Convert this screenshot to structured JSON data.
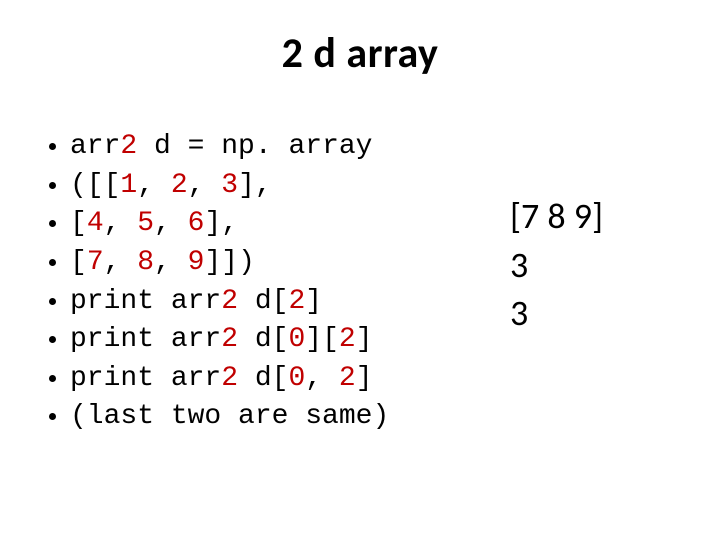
{
  "title": "2 d array",
  "code_lines": [
    [
      {
        "t": "arr",
        "c": "black"
      },
      {
        "t": "2",
        "c": "red"
      },
      {
        "t": " d = np. array",
        "c": "black"
      }
    ],
    [
      {
        "t": "([[",
        "c": "black"
      },
      {
        "t": "1",
        "c": "red"
      },
      {
        "t": ", ",
        "c": "black"
      },
      {
        "t": "2",
        "c": "red"
      },
      {
        "t": ", ",
        "c": "black"
      },
      {
        "t": "3",
        "c": "red"
      },
      {
        "t": "],",
        "c": "black"
      }
    ],
    [
      {
        "t": "[",
        "c": "black"
      },
      {
        "t": "4",
        "c": "red"
      },
      {
        "t": ", ",
        "c": "black"
      },
      {
        "t": "5",
        "c": "red"
      },
      {
        "t": ", ",
        "c": "black"
      },
      {
        "t": "6",
        "c": "red"
      },
      {
        "t": "],",
        "c": "black"
      }
    ],
    [
      {
        "t": "[",
        "c": "black"
      },
      {
        "t": "7",
        "c": "red"
      },
      {
        "t": ", ",
        "c": "black"
      },
      {
        "t": "8",
        "c": "red"
      },
      {
        "t": ", ",
        "c": "black"
      },
      {
        "t": "9",
        "c": "red"
      },
      {
        "t": "]])",
        "c": "black"
      }
    ],
    [
      {
        "t": "print arr",
        "c": "black"
      },
      {
        "t": "2",
        "c": "red"
      },
      {
        "t": " d[",
        "c": "black"
      },
      {
        "t": "2",
        "c": "red"
      },
      {
        "t": "]",
        "c": "black"
      }
    ],
    [
      {
        "t": "print arr",
        "c": "black"
      },
      {
        "t": "2",
        "c": "red"
      },
      {
        "t": " d[",
        "c": "black"
      },
      {
        "t": "0",
        "c": "red"
      },
      {
        "t": "][",
        "c": "black"
      },
      {
        "t": "2",
        "c": "red"
      },
      {
        "t": "]",
        "c": "black"
      }
    ],
    [
      {
        "t": "print arr",
        "c": "black"
      },
      {
        "t": "2",
        "c": "red"
      },
      {
        "t": " d[",
        "c": "black"
      },
      {
        "t": "0",
        "c": "red"
      },
      {
        "t": ", ",
        "c": "black"
      },
      {
        "t": "2",
        "c": "red"
      },
      {
        "t": "]",
        "c": "black"
      }
    ],
    [
      {
        "t": "(last two are same)",
        "c": "black"
      }
    ]
  ],
  "output_lines": [
    "[7 8 9]",
    "3",
    "3"
  ]
}
